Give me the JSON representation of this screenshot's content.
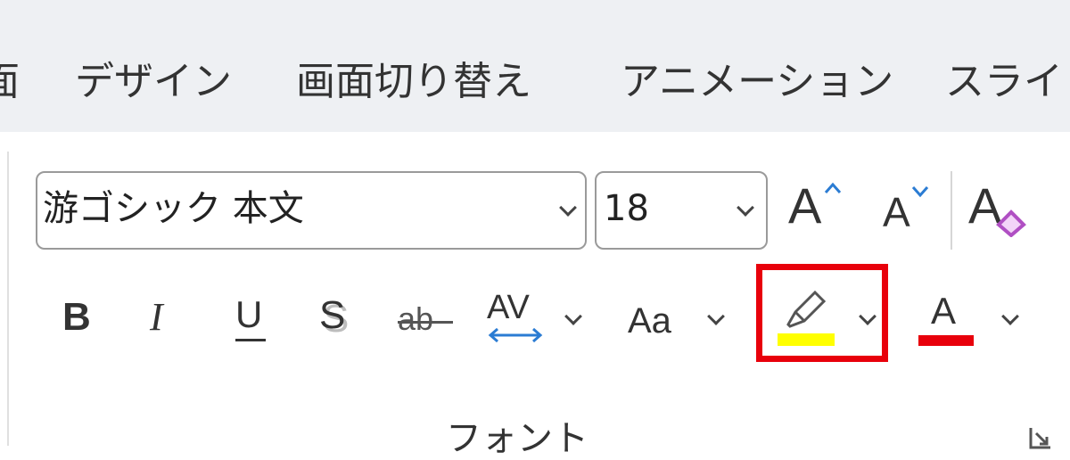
{
  "tabs": [
    {
      "label": "面"
    },
    {
      "label": "デザイン"
    },
    {
      "label": "画面切り替え"
    },
    {
      "label": "アニメーション"
    },
    {
      "label": "スライド"
    }
  ],
  "font_group": {
    "font_name": "游ゴシック 本文",
    "font_size": "18",
    "label": "フォント",
    "icons": {
      "grow_font": "grow-font-icon",
      "shrink_font": "shrink-font-icon",
      "clear_formatting": "clear-formatting-icon",
      "bold": "bold-icon",
      "italic": "italic-icon",
      "underline": "underline-icon",
      "shadow": "text-shadow-icon",
      "strikethrough": "strikethrough-icon",
      "char_spacing": "character-spacing-icon",
      "change_case": "change-case-icon",
      "highlight": "highlighter-icon",
      "font_color": "font-color-icon"
    },
    "glyphs": {
      "grow_font": "A",
      "shrink_font": "A",
      "clear_formatting": "A",
      "bold": "B",
      "italic": "I",
      "underline": "U",
      "shadow": "S",
      "strikethrough": "ab",
      "char_spacing": "AV",
      "change_case": "Aa",
      "font_color": "A"
    }
  },
  "colors": {
    "highlight_color": "#ffff00",
    "font_color": "#e8000b",
    "annotation_box": "#e8000b",
    "char_spacing_arrow": "#2b7cd3",
    "eraser": "#b04fc3",
    "tab_bar_bg": "#eef0f3"
  }
}
